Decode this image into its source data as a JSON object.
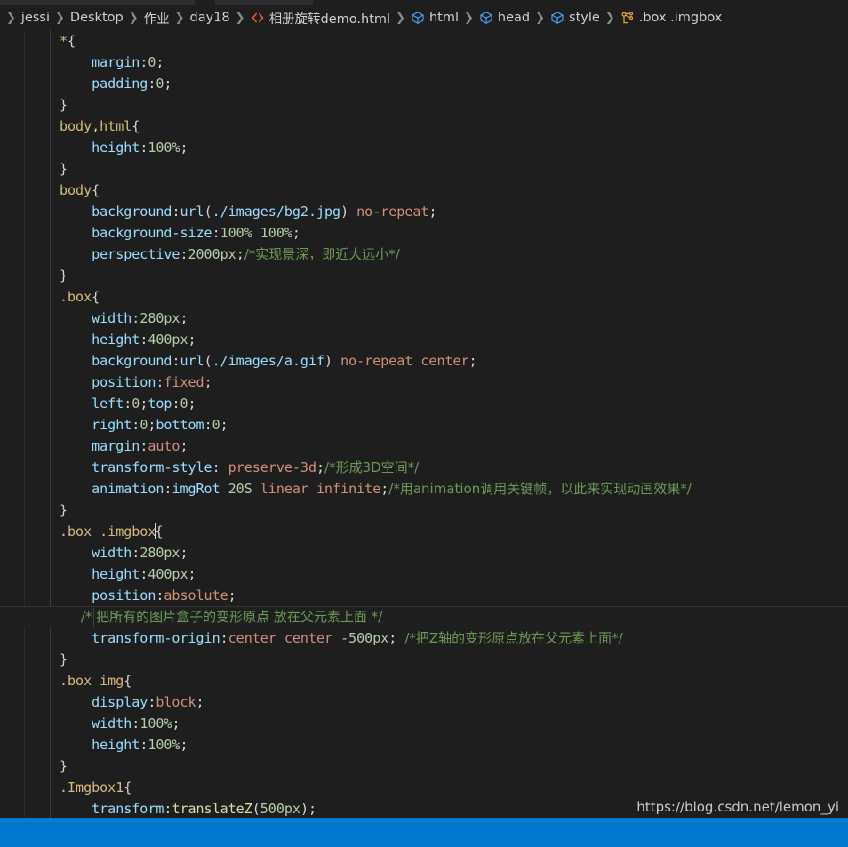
{
  "window": {
    "theme_bg": "#1e1e1e",
    "accent": "#0078ce"
  },
  "tabs": {
    "active_tab_present": true,
    "other_tab_present": true
  },
  "breadcrumb": {
    "items": [
      {
        "label": "jessi",
        "icon": "none"
      },
      {
        "label": "Desktop",
        "icon": "none"
      },
      {
        "label": "作业",
        "icon": "none"
      },
      {
        "label": "day18",
        "icon": "none"
      },
      {
        "label": "相册旋转demo.html",
        "icon": "html-file-icon"
      },
      {
        "label": "html",
        "icon": "symbol-namespace-icon"
      },
      {
        "label": "head",
        "icon": "symbol-namespace-icon"
      },
      {
        "label": "style",
        "icon": "symbol-namespace-icon"
      },
      {
        "label": ".box .imgbox",
        "icon": "css-rule-icon"
      }
    ],
    "separator": "❯"
  },
  "code": {
    "language": "css",
    "lines": [
      {
        "indent": 0,
        "current": false,
        "tokens": [
          {
            "c": "t-sel",
            "t": "*"
          },
          {
            "c": "t-punc",
            "t": "{"
          }
        ]
      },
      {
        "indent": 1,
        "current": false,
        "tokens": [
          {
            "c": "t-prop",
            "t": "    margin"
          },
          {
            "c": "t-punc",
            "t": ":"
          },
          {
            "c": "t-num",
            "t": "0"
          },
          {
            "c": "t-punc",
            "t": ";"
          }
        ]
      },
      {
        "indent": 1,
        "current": false,
        "tokens": [
          {
            "c": "t-prop",
            "t": "    padding"
          },
          {
            "c": "t-punc",
            "t": ":"
          },
          {
            "c": "t-num",
            "t": "0"
          },
          {
            "c": "t-punc",
            "t": ";"
          }
        ]
      },
      {
        "indent": 0,
        "current": false,
        "tokens": [
          {
            "c": "t-punc",
            "t": "}"
          }
        ]
      },
      {
        "indent": 0,
        "current": false,
        "tokens": [
          {
            "c": "t-sel",
            "t": "body"
          },
          {
            "c": "t-punc",
            "t": ","
          },
          {
            "c": "t-sel",
            "t": "html"
          },
          {
            "c": "t-punc",
            "t": "{"
          }
        ]
      },
      {
        "indent": 1,
        "current": false,
        "tokens": [
          {
            "c": "t-prop",
            "t": "    height"
          },
          {
            "c": "t-punc",
            "t": ":"
          },
          {
            "c": "t-num",
            "t": "100%"
          },
          {
            "c": "t-punc",
            "t": ";"
          }
        ]
      },
      {
        "indent": 0,
        "current": false,
        "tokens": [
          {
            "c": "t-punc",
            "t": "}"
          }
        ]
      },
      {
        "indent": 0,
        "current": false,
        "tokens": [
          {
            "c": "t-sel",
            "t": "body"
          },
          {
            "c": "t-punc",
            "t": "{"
          }
        ]
      },
      {
        "indent": 1,
        "current": false,
        "tokens": [
          {
            "c": "t-prop",
            "t": "    background"
          },
          {
            "c": "t-punc",
            "t": ":"
          },
          {
            "c": "t-prop",
            "t": "url"
          },
          {
            "c": "t-punc",
            "t": "("
          },
          {
            "c": "t-prop",
            "t": "./images/bg2.jpg"
          },
          {
            "c": "t-punc",
            "t": ")"
          },
          {
            "c": "t-val",
            "t": " no-repeat"
          },
          {
            "c": "t-punc",
            "t": ";"
          }
        ]
      },
      {
        "indent": 1,
        "current": false,
        "tokens": [
          {
            "c": "t-prop",
            "t": "    background-size"
          },
          {
            "c": "t-punc",
            "t": ":"
          },
          {
            "c": "t-num",
            "t": "100% 100%"
          },
          {
            "c": "t-punc",
            "t": ";"
          }
        ]
      },
      {
        "indent": 1,
        "current": false,
        "tokens": [
          {
            "c": "t-prop",
            "t": "    perspective"
          },
          {
            "c": "t-punc",
            "t": ":"
          },
          {
            "c": "t-num",
            "t": "2000px"
          },
          {
            "c": "t-punc",
            "t": ";"
          },
          {
            "c": "t-com t-cjk",
            "t": "/*实现景深，即近大远小*/"
          }
        ]
      },
      {
        "indent": 0,
        "current": false,
        "tokens": [
          {
            "c": "t-punc",
            "t": "}"
          }
        ]
      },
      {
        "indent": 0,
        "current": false,
        "tokens": [
          {
            "c": "t-sel",
            "t": ".box"
          },
          {
            "c": "t-punc",
            "t": "{"
          }
        ]
      },
      {
        "indent": 1,
        "current": false,
        "tokens": [
          {
            "c": "t-prop",
            "t": "    width"
          },
          {
            "c": "t-punc",
            "t": ":"
          },
          {
            "c": "t-num",
            "t": "280px"
          },
          {
            "c": "t-punc",
            "t": ";"
          }
        ]
      },
      {
        "indent": 1,
        "current": false,
        "tokens": [
          {
            "c": "t-prop",
            "t": "    height"
          },
          {
            "c": "t-punc",
            "t": ":"
          },
          {
            "c": "t-num",
            "t": "400px"
          },
          {
            "c": "t-punc",
            "t": ";"
          }
        ]
      },
      {
        "indent": 1,
        "current": false,
        "tokens": [
          {
            "c": "t-prop",
            "t": "    background"
          },
          {
            "c": "t-punc",
            "t": ":"
          },
          {
            "c": "t-prop",
            "t": "url"
          },
          {
            "c": "t-punc",
            "t": "("
          },
          {
            "c": "t-prop",
            "t": "./images/a.gif"
          },
          {
            "c": "t-punc",
            "t": ")"
          },
          {
            "c": "t-val",
            "t": " no-repeat center"
          },
          {
            "c": "t-punc",
            "t": ";"
          }
        ]
      },
      {
        "indent": 1,
        "current": false,
        "tokens": [
          {
            "c": "t-prop",
            "t": "    position"
          },
          {
            "c": "t-punc",
            "t": ":"
          },
          {
            "c": "t-val",
            "t": "fixed"
          },
          {
            "c": "t-punc",
            "t": ";"
          }
        ]
      },
      {
        "indent": 1,
        "current": false,
        "tokens": [
          {
            "c": "t-prop",
            "t": "    left"
          },
          {
            "c": "t-punc",
            "t": ":"
          },
          {
            "c": "t-num",
            "t": "0"
          },
          {
            "c": "t-punc",
            "t": ";"
          },
          {
            "c": "t-prop",
            "t": "top"
          },
          {
            "c": "t-punc",
            "t": ":"
          },
          {
            "c": "t-num",
            "t": "0"
          },
          {
            "c": "t-punc",
            "t": ";"
          }
        ]
      },
      {
        "indent": 1,
        "current": false,
        "tokens": [
          {
            "c": "t-prop",
            "t": "    right"
          },
          {
            "c": "t-punc",
            "t": ":"
          },
          {
            "c": "t-num",
            "t": "0"
          },
          {
            "c": "t-punc",
            "t": ";"
          },
          {
            "c": "t-prop",
            "t": "bottom"
          },
          {
            "c": "t-punc",
            "t": ":"
          },
          {
            "c": "t-num",
            "t": "0"
          },
          {
            "c": "t-punc",
            "t": ";"
          }
        ]
      },
      {
        "indent": 1,
        "current": false,
        "tokens": [
          {
            "c": "t-prop",
            "t": "    margin"
          },
          {
            "c": "t-punc",
            "t": ":"
          },
          {
            "c": "t-val",
            "t": "auto"
          },
          {
            "c": "t-punc",
            "t": ";"
          }
        ]
      },
      {
        "indent": 1,
        "current": false,
        "tokens": [
          {
            "c": "t-prop",
            "t": "    transform-style"
          },
          {
            "c": "t-punc",
            "t": ": "
          },
          {
            "c": "t-val",
            "t": "preserve-3d"
          },
          {
            "c": "t-punc",
            "t": ";"
          },
          {
            "c": "t-com t-cjk",
            "t": "/*形成3D空间*/"
          }
        ]
      },
      {
        "indent": 1,
        "current": false,
        "tokens": [
          {
            "c": "t-prop",
            "t": "    animation"
          },
          {
            "c": "t-punc",
            "t": ":"
          },
          {
            "c": "t-prop",
            "t": "imgRot "
          },
          {
            "c": "t-num",
            "t": "20S"
          },
          {
            "c": "t-val",
            "t": " linear infinite"
          },
          {
            "c": "t-punc",
            "t": ";"
          },
          {
            "c": "t-com t-cjk",
            "t": "/*用animation调用关键帧，以此来实现动画效果*/"
          }
        ]
      },
      {
        "indent": 0,
        "current": false,
        "tokens": [
          {
            "c": "t-punc",
            "t": "}"
          }
        ]
      },
      {
        "indent": 0,
        "current": false,
        "tokens": [
          {
            "c": "t-sel",
            "t": ".box .imgbox"
          },
          {
            "c": "caret",
            "t": ""
          },
          {
            "c": "t-punc",
            "t": "{"
          }
        ]
      },
      {
        "indent": 1,
        "current": false,
        "tokens": [
          {
            "c": "t-prop",
            "t": "    width"
          },
          {
            "c": "t-punc",
            "t": ":"
          },
          {
            "c": "t-num",
            "t": "280px"
          },
          {
            "c": "t-punc",
            "t": ";"
          }
        ]
      },
      {
        "indent": 1,
        "current": false,
        "tokens": [
          {
            "c": "t-prop",
            "t": "    height"
          },
          {
            "c": "t-punc",
            "t": ":"
          },
          {
            "c": "t-num",
            "t": "400px"
          },
          {
            "c": "t-punc",
            "t": ";"
          }
        ]
      },
      {
        "indent": 1,
        "current": false,
        "tokens": [
          {
            "c": "t-prop",
            "t": "    position"
          },
          {
            "c": "t-punc",
            "t": ":"
          },
          {
            "c": "t-val",
            "t": "absolute"
          },
          {
            "c": "t-punc",
            "t": ";"
          }
        ]
      },
      {
        "indent": 2,
        "current": true,
        "tokens": [
          {
            "c": "t-com t-cjk",
            "t": "     /* 把所有的图片盒子的变形原点 放在父元素上面 */"
          }
        ]
      },
      {
        "indent": 1,
        "current": false,
        "tokens": [
          {
            "c": "t-prop",
            "t": "    transform-origin"
          },
          {
            "c": "t-punc",
            "t": ":"
          },
          {
            "c": "t-val",
            "t": "center center "
          },
          {
            "c": "t-num",
            "t": "-500px"
          },
          {
            "c": "t-punc",
            "t": "; "
          },
          {
            "c": "t-com t-cjk",
            "t": "/*把Z轴的变形原点放在父元素上面*/"
          }
        ]
      },
      {
        "indent": 0,
        "current": false,
        "tokens": [
          {
            "c": "t-punc",
            "t": "}"
          }
        ]
      },
      {
        "indent": 0,
        "current": false,
        "tokens": [
          {
            "c": "t-sel",
            "t": ".box img"
          },
          {
            "c": "t-punc",
            "t": "{"
          }
        ]
      },
      {
        "indent": 1,
        "current": false,
        "tokens": [
          {
            "c": "t-prop",
            "t": "    display"
          },
          {
            "c": "t-punc",
            "t": ":"
          },
          {
            "c": "t-val",
            "t": "block"
          },
          {
            "c": "t-punc",
            "t": ";"
          }
        ]
      },
      {
        "indent": 1,
        "current": false,
        "tokens": [
          {
            "c": "t-prop",
            "t": "    width"
          },
          {
            "c": "t-punc",
            "t": ":"
          },
          {
            "c": "t-num",
            "t": "100%"
          },
          {
            "c": "t-punc",
            "t": ";"
          }
        ]
      },
      {
        "indent": 1,
        "current": false,
        "tokens": [
          {
            "c": "t-prop",
            "t": "    height"
          },
          {
            "c": "t-punc",
            "t": ":"
          },
          {
            "c": "t-num",
            "t": "100%"
          },
          {
            "c": "t-punc",
            "t": ";"
          }
        ]
      },
      {
        "indent": 0,
        "current": false,
        "tokens": [
          {
            "c": "t-punc",
            "t": "}"
          }
        ]
      },
      {
        "indent": 0,
        "current": false,
        "tokens": [
          {
            "c": "t-sel",
            "t": ".Imgbox1"
          },
          {
            "c": "t-punc",
            "t": "{"
          }
        ]
      },
      {
        "indent": 1,
        "current": false,
        "tokens": [
          {
            "c": "t-prop",
            "t": "    transform"
          },
          {
            "c": "t-punc",
            "t": ":"
          },
          {
            "c": "t-fn",
            "t": "translateZ"
          },
          {
            "c": "t-punc",
            "t": "("
          },
          {
            "c": "t-num",
            "t": "500px"
          },
          {
            "c": "t-punc",
            "t": ");"
          }
        ]
      },
      {
        "indent": 0,
        "current": false,
        "tokens": [
          {
            "c": "t-punc",
            "t": "}"
          }
        ]
      }
    ]
  },
  "statusbar": {
    "watermark": "https://blog.csdn.net/lemon_yi"
  }
}
